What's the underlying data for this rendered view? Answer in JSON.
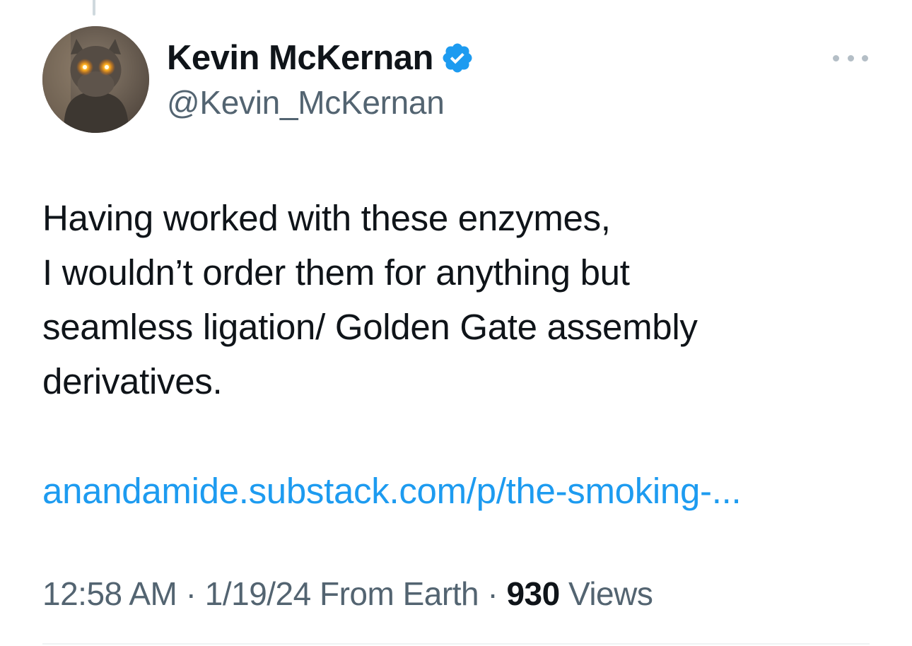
{
  "colors": {
    "text_primary": "#0f1419",
    "text_secondary": "#536471",
    "link": "#1d9bf0",
    "verified_badge": "#1d9bf0",
    "background": "#ffffff"
  },
  "author": {
    "display_name": "Kevin McKernan",
    "handle": "@Kevin_McKernan",
    "verified": true,
    "verified_icon": "verified-badge-icon",
    "avatar": "cat-with-glowing-eyes-avatar"
  },
  "menu": {
    "icon": "more-options-icon"
  },
  "tweet": {
    "lines": [
      "Having worked with these enzymes,",
      "I wouldn’t order them for anything but",
      "seamless ligation/ Golden Gate assembly",
      "derivatives."
    ],
    "link": "anandamide.substack.com/p/the-smoking-..."
  },
  "meta": {
    "time": "12:58 AM",
    "sep1": "·",
    "date": "1/19/24",
    "source": "From Earth",
    "sep2": "·",
    "views_count": "930",
    "views_label": "Views"
  }
}
